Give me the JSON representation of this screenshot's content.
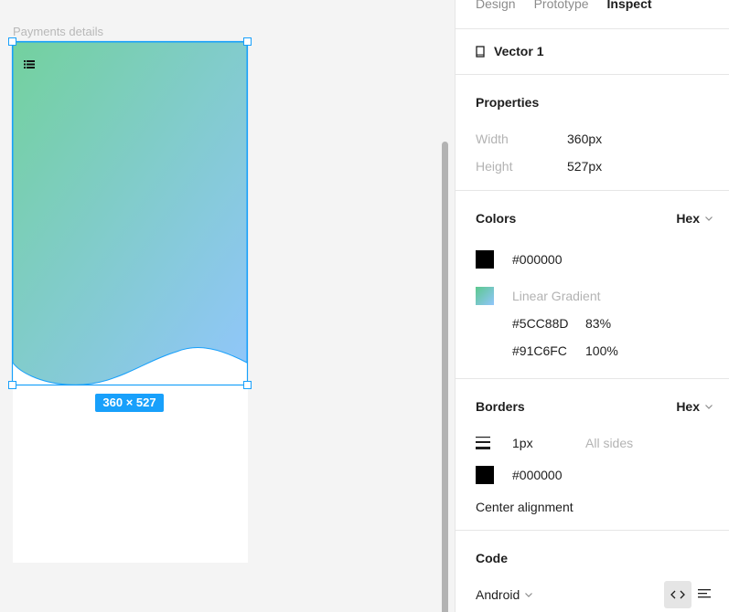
{
  "canvas": {
    "frame_label": "Payments details",
    "size_badge": "360 × 527"
  },
  "panel": {
    "tabs": [
      {
        "label": "Design",
        "active": false
      },
      {
        "label": "Prototype",
        "active": false
      },
      {
        "label": "Inspect",
        "active": true
      }
    ],
    "layer_name": "Vector 1",
    "properties": {
      "title": "Properties",
      "width_label": "Width",
      "width_value": "360px",
      "height_label": "Height",
      "height_value": "527px"
    },
    "colors": {
      "title": "Colors",
      "format": "Hex",
      "solid_hex": "#000000",
      "gradient_label": "Linear Gradient",
      "stops": [
        {
          "hex": "#5CC88D",
          "pct": "83%"
        },
        {
          "hex": "#91C6FC",
          "pct": "100%"
        }
      ]
    },
    "borders": {
      "title": "Borders",
      "format": "Hex",
      "weight": "1px",
      "sides": "All sides",
      "color_hex": "#000000",
      "alignment": "Center alignment"
    },
    "code": {
      "title": "Code",
      "platform": "Android"
    }
  },
  "colors": {
    "selection": "#18a0fb",
    "gradient_start": "#5CC88D",
    "gradient_end": "#91C6FC"
  }
}
